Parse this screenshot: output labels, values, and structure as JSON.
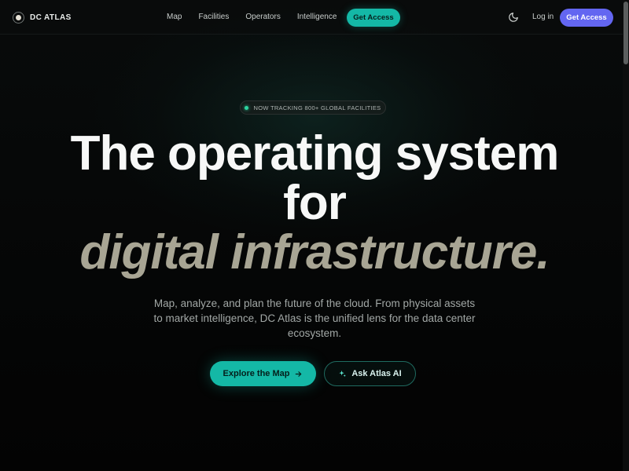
{
  "nav": {
    "brand": "DC ATLAS",
    "brand_icon": "brand-circle-icon",
    "links": [
      "Map",
      "Facilities",
      "Operators",
      "Intelligence"
    ],
    "cta_label": "Get Access",
    "theme_icon": "moon-icon",
    "login_label": "Log in",
    "cta2_label": "Get Access"
  },
  "hero": {
    "badge_text": "NOW TRACKING 800+ GLOBAL FACILITIES",
    "headline_line1": "The operating system",
    "headline_line2": "for",
    "headline_accent": "digital infrastructure.",
    "subtext": "Map, analyze, and plan the future of the cloud. From physical assets to market intelligence, DC Atlas is the unified lens for the data center ecosystem.",
    "primary_cta": "Explore the Map",
    "primary_cta_icon": "arrow-right-icon",
    "secondary_cta": "Ask Atlas AI",
    "secondary_cta_icon": "sparkle-icon"
  },
  "colors": {
    "accent_teal": "#14b8a6",
    "accent_indigo": "#6366f1",
    "headline_accent": "#a8a594",
    "background": "#040506"
  }
}
